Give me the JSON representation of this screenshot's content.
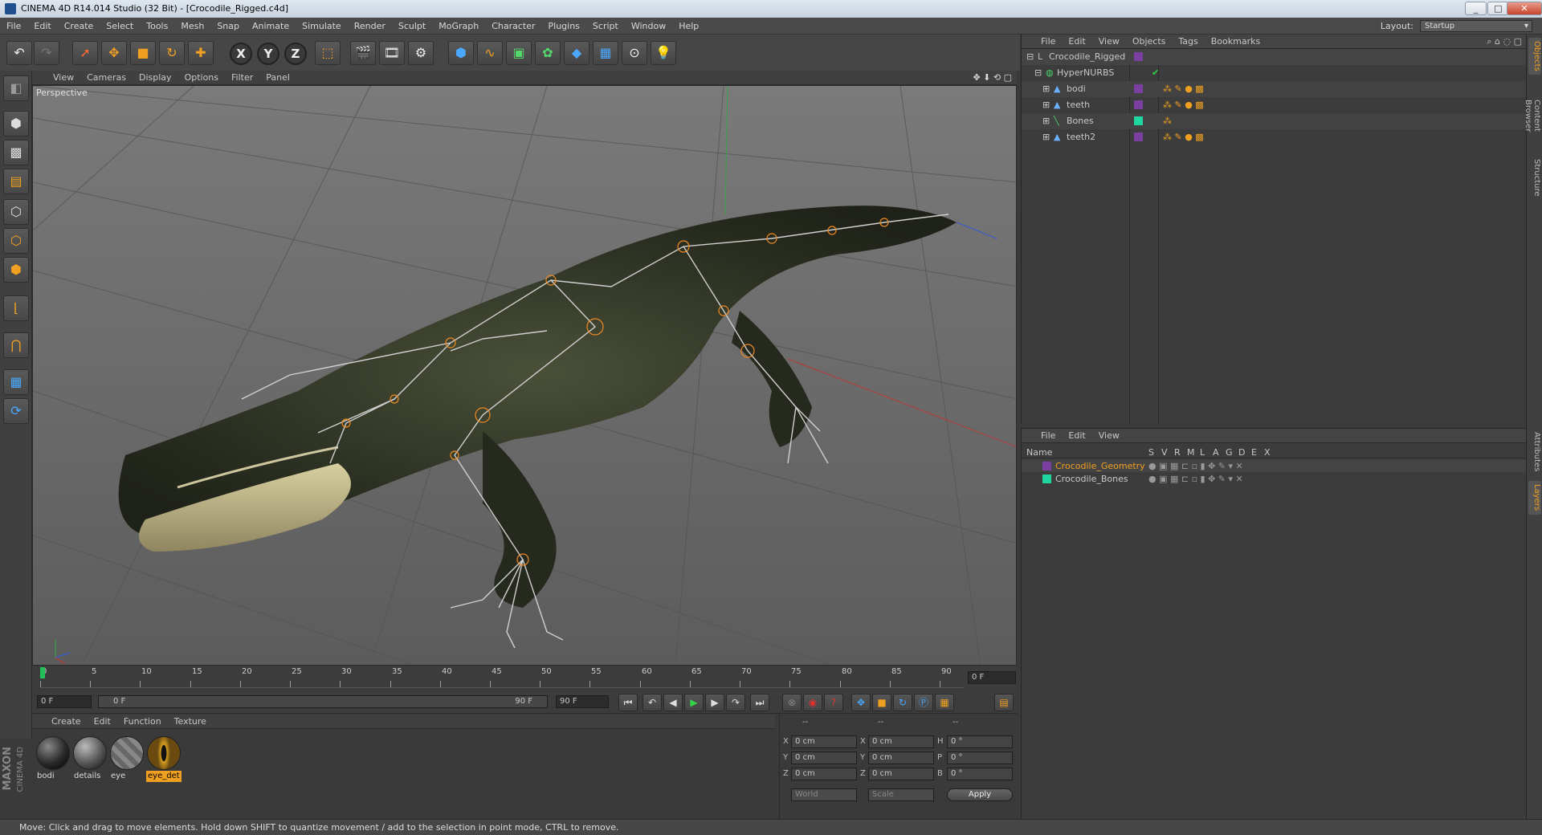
{
  "window": {
    "title": "CINEMA 4D R14.014 Studio (32 Bit) - [Crocodile_Rigged.c4d]",
    "btn_min": "_",
    "btn_max": "□",
    "btn_close": "✕"
  },
  "menubar": {
    "items": [
      "File",
      "Edit",
      "Create",
      "Select",
      "Tools",
      "Mesh",
      "Snap",
      "Animate",
      "Simulate",
      "Render",
      "Sculpt",
      "MoGraph",
      "Character",
      "Plugins",
      "Script",
      "Window",
      "Help"
    ],
    "layout_label": "Layout:",
    "layout_value": "Startup"
  },
  "viewport": {
    "menu": [
      "View",
      "Cameras",
      "Display",
      "Options",
      "Filter",
      "Panel"
    ],
    "label": "Perspective"
  },
  "timeline": {
    "ticks": [
      "0",
      "5",
      "10",
      "15",
      "20",
      "25",
      "30",
      "35",
      "40",
      "45",
      "50",
      "55",
      "60",
      "65",
      "70",
      "75",
      "80",
      "85",
      "90"
    ],
    "current_frame": "0 F",
    "start_field": "0 F",
    "range_start": "0 F",
    "range_end": "90 F",
    "end_field": "90 F"
  },
  "material_manager": {
    "menu": [
      "Create",
      "Edit",
      "Function",
      "Texture"
    ],
    "materials": [
      {
        "name": "bodi",
        "color": "#2a2a2a"
      },
      {
        "name": "details",
        "color": "#555"
      },
      {
        "name": "eye",
        "color": "#777"
      },
      {
        "name": "eye_det",
        "color": "#c89020"
      }
    ]
  },
  "coords": {
    "header_left": "--",
    "header_mid": "--",
    "header_right": "--",
    "rows": [
      {
        "a": "X",
        "v1": "0 cm",
        "b": "X",
        "v2": "0 cm",
        "c": "H",
        "v3": "0 °"
      },
      {
        "a": "Y",
        "v1": "0 cm",
        "b": "Y",
        "v2": "0 cm",
        "c": "P",
        "v3": "0 °"
      },
      {
        "a": "Z",
        "v1": "0 cm",
        "b": "Z",
        "v2": "0 cm",
        "c": "B",
        "v3": "0 °"
      }
    ],
    "mode1": "World",
    "mode2": "Scale",
    "apply": "Apply"
  },
  "object_manager": {
    "menu": [
      "File",
      "Edit",
      "View",
      "Objects",
      "Tags",
      "Bookmarks"
    ],
    "objects": [
      {
        "name": "Crocodile_Rigged",
        "indent": 0,
        "color": "#7a3fa0"
      },
      {
        "name": "HyperNURBS",
        "indent": 1,
        "color": ""
      },
      {
        "name": "bodi",
        "indent": 2,
        "color": "#7a3fa0"
      },
      {
        "name": "teeth",
        "indent": 2,
        "color": "#7a3fa0"
      },
      {
        "name": "Bones",
        "indent": 2,
        "color": "#1fd6a0"
      },
      {
        "name": "teeth2",
        "indent": 2,
        "color": "#7a3fa0"
      }
    ]
  },
  "layer_manager": {
    "menu": [
      "File",
      "Edit",
      "View"
    ],
    "columns": [
      "Name",
      "S",
      "V",
      "R",
      "M",
      "L",
      "A",
      "G",
      "D",
      "E",
      "X"
    ],
    "layers": [
      {
        "name": "Crocodile_Geometry",
        "color": "#7a3fa0",
        "highlight": true
      },
      {
        "name": "Crocodile_Bones",
        "color": "#1fd6a0",
        "highlight": false
      }
    ]
  },
  "right_tabs": [
    "Objects",
    "Content Browser",
    "Structure",
    "Attributes",
    "Layers"
  ],
  "brand": {
    "line1": "MAXON",
    "line2": "CINEMA 4D"
  },
  "status": "Move: Click and drag to move elements. Hold down SHIFT to quantize movement / add to the selection in point mode, CTRL to remove."
}
